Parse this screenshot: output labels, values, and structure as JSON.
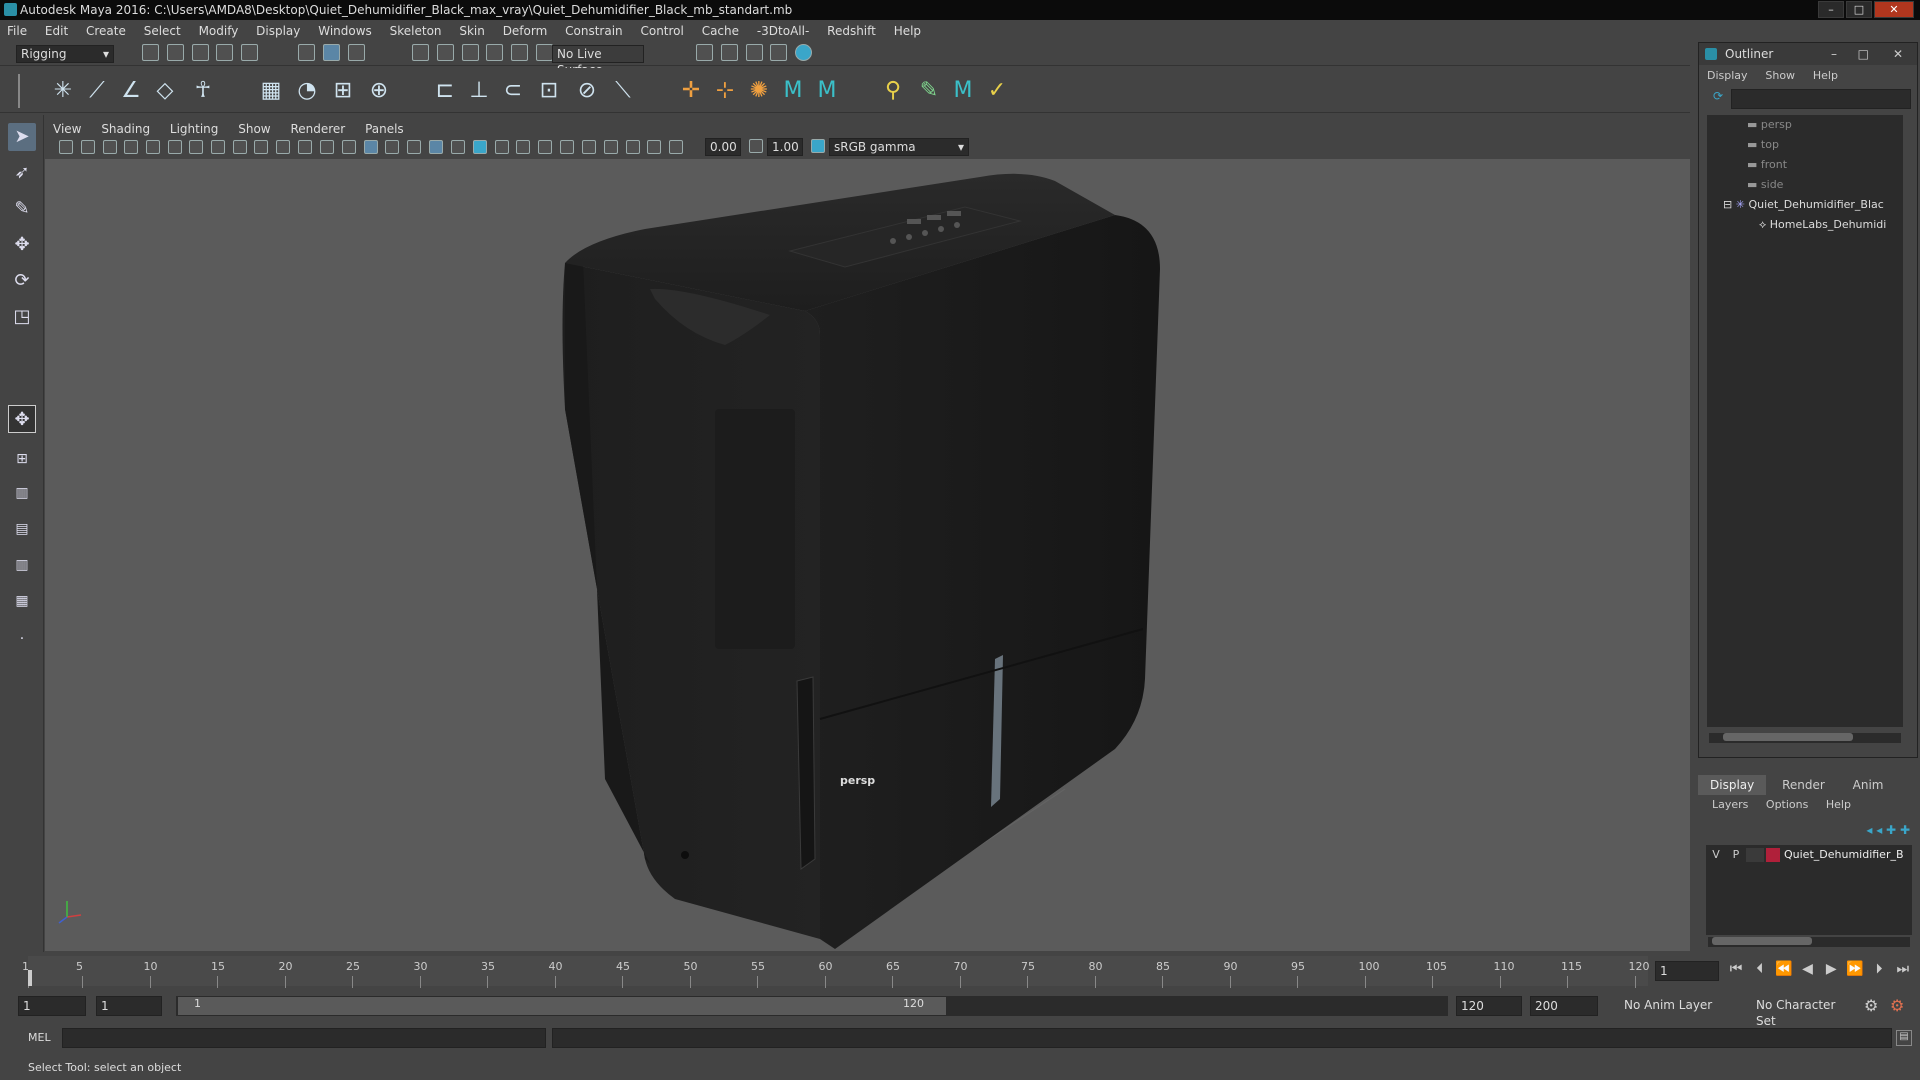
{
  "window": {
    "title": "Autodesk Maya 2016: C:\\Users\\AMDA8\\Desktop\\Quiet_Dehumidifier_Black_max_vray\\Quiet_Dehumidifier_Black_mb_standart.mb",
    "minimize": "–",
    "maximize": "□",
    "close": "✕"
  },
  "menubar": [
    "File",
    "Edit",
    "Create",
    "Select",
    "Modify",
    "Display",
    "Windows",
    "Skeleton",
    "Skin",
    "Deform",
    "Constrain",
    "Control",
    "Cache",
    "-3DtoAll-",
    "Redshift",
    "Help"
  ],
  "statusline": {
    "menuset": "Rigging",
    "live_surface": "No Live Surface"
  },
  "viewport": {
    "menus": [
      "View",
      "Shading",
      "Lighting",
      "Show",
      "Renderer",
      "Panels"
    ],
    "exposure": "0.00",
    "gamma": "1.00",
    "colorspace": "sRGB gamma",
    "camera_label": "persp"
  },
  "outliner": {
    "title": "Outliner",
    "menus": [
      "Display",
      "Show",
      "Help"
    ],
    "items": [
      "persp",
      "top",
      "front",
      "side",
      "Quiet_Dehumidifier_Blac",
      "HomeLabs_Dehumidi"
    ]
  },
  "layers": {
    "tabs": [
      "Display",
      "Render",
      "Anim"
    ],
    "menus": [
      "Layers",
      "Options",
      "Help"
    ],
    "row": {
      "v": "V",
      "p": "P",
      "name": "Quiet_Dehumidifier_B",
      "color": "#b0203a"
    }
  },
  "timeline": {
    "ticks": [
      "1",
      "5",
      "10",
      "15",
      "20",
      "25",
      "30",
      "35",
      "40",
      "45",
      "50",
      "55",
      "60",
      "65",
      "70",
      "75",
      "80",
      "85",
      "90",
      "95",
      "100",
      "105",
      "110",
      "115",
      "120"
    ],
    "current_frame": "1"
  },
  "range": {
    "start": "1",
    "anim_start": "1",
    "slider_start": "1",
    "slider_end": "120",
    "end": "120",
    "anim_end": "200",
    "anim_layer": "No Anim Layer",
    "char_set": "No Character Set"
  },
  "cmdline": {
    "label": "MEL"
  },
  "helpline": {
    "text": "Select Tool: select an object"
  }
}
